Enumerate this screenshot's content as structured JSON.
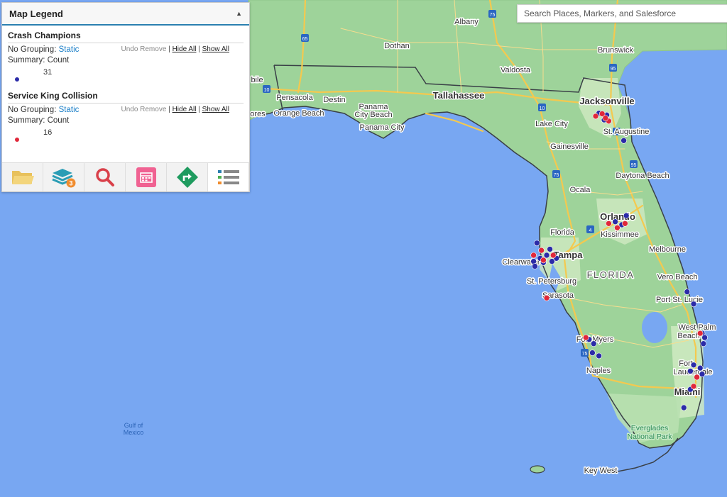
{
  "legend": {
    "title": "Map Legend",
    "collapse_icon": "▲",
    "layers": [
      {
        "name": "Crash Champions",
        "grouping_label": "No Grouping:",
        "grouping_value": "Static",
        "summary_label": "Summary:",
        "summary_value": "Count",
        "undo_remove": "Undo Remove",
        "hide_all": "Hide All",
        "show_all": "Show All",
        "separator": "|",
        "count": "31",
        "color": "#2b2ba8"
      },
      {
        "name": "Service King Collision",
        "grouping_label": "No Grouping:",
        "grouping_value": "Static",
        "summary_label": "Summary:",
        "summary_value": "Count",
        "undo_remove": "Undo Remove",
        "hide_all": "Hide All",
        "show_all": "Show All",
        "separator": "|",
        "count": "16",
        "color": "#e0283a"
      }
    ]
  },
  "toolbar": {
    "buttons": [
      {
        "icon": "folder-icon",
        "color": "#e8c15c"
      },
      {
        "icon": "layers-icon",
        "color": "#2a9db5",
        "badge": "3",
        "badge_color": "#f08c2e"
      },
      {
        "icon": "search-icon",
        "color": "#d9404a"
      },
      {
        "icon": "calendar-icon",
        "color": "#f06292"
      },
      {
        "icon": "directions-icon",
        "color": "#1f9b5f"
      },
      {
        "icon": "legend-list-icon",
        "color": "#888888",
        "active": true
      }
    ]
  },
  "search": {
    "placeholder": "Search Places, Markers, and Salesforce"
  },
  "map": {
    "state_label": "FLORIDA",
    "water_label_line1": "Gulf of",
    "water_label_line2": "Mexico",
    "park_label_line1": "Everglades",
    "park_label_line2": "National Park",
    "cities": {
      "albany": "Albany",
      "dothan": "Dothan",
      "brunswick": "Brunswick",
      "valdosta": "Valdosta",
      "pensacola": "Pensacola",
      "destin": "Destin",
      "orange_beach": "Orange Beach",
      "panama_city_beach_1": "Panama",
      "panama_city_beach_2": "City Beach",
      "panama_city": "Panama City",
      "tallahassee": "Tallahassee",
      "jacksonville": "Jacksonville",
      "lake_city": "Lake City",
      "st_augustine": "St. Augustine",
      "gainesville": "Gainesville",
      "daytona_beach": "Daytona Beach",
      "ocala": "Ocala",
      "orlando": "Orlando",
      "kissimmee": "Kissimmee",
      "melbourne": "Melbourne",
      "florida_city": "Florida",
      "tampa": "Tampa",
      "clearwater": "Clearwater",
      "st_petersburg": "St. Petersburg",
      "sarasota": "Sarasota",
      "vero_beach": "Vero Beach",
      "port_st_lucie": "Port St. Lucie",
      "west_palm_1": "West Palm",
      "west_palm_2": "Beach",
      "fort_myers": "Fort Myers",
      "naples": "Naples",
      "fort_lauderdale_1": "Fort",
      "fort_lauderdale_2": "Lauderdale",
      "miami": "Miami",
      "key_west": "Key West",
      "mobile_partial": "bile",
      "gores_partial": "ores"
    },
    "highway_shields": [
      "65",
      "10",
      "75",
      "95",
      "4",
      "75",
      "95",
      "75",
      "95",
      "10"
    ],
    "colors": {
      "water": "#78a7f2",
      "land": "#9ed39a",
      "land_light": "#cfeac2",
      "road": "#f4c94f",
      "border": "#3a4047"
    }
  },
  "markers": {
    "crash_champions": [
      [
        -81.7,
        30.33
      ],
      [
        -81.58,
        30.3
      ],
      [
        -81.62,
        30.22
      ],
      [
        -81.32,
        29.88
      ],
      [
        -81.28,
        28.65
      ],
      [
        -81.45,
        28.55
      ],
      [
        -81.35,
        28.5
      ],
      [
        -82.65,
        28.2
      ],
      [
        -82.45,
        28.1
      ],
      [
        -82.5,
        28.0
      ],
      [
        -82.6,
        27.95
      ],
      [
        -82.55,
        27.88
      ],
      [
        -82.7,
        27.9
      ],
      [
        -82.68,
        27.82
      ],
      [
        -82.35,
        27.95
      ],
      [
        -82.42,
        27.9
      ],
      [
        -80.35,
        27.4
      ],
      [
        -80.25,
        27.2
      ],
      [
        -80.12,
        26.72
      ],
      [
        -80.08,
        26.65
      ],
      [
        -80.1,
        26.55
      ],
      [
        -81.85,
        26.62
      ],
      [
        -81.78,
        26.55
      ],
      [
        -81.8,
        26.4
      ],
      [
        -81.7,
        26.35
      ],
      [
        -80.25,
        26.2
      ],
      [
        -80.15,
        26.15
      ],
      [
        -80.12,
        26.05
      ],
      [
        -80.3,
        26.1
      ],
      [
        -80.3,
        25.8
      ],
      [
        -80.4,
        25.5
      ]
    ],
    "service_king": [
      [
        -81.75,
        30.28
      ],
      [
        -81.65,
        30.32
      ],
      [
        -81.55,
        30.2
      ],
      [
        -81.6,
        30.25
      ],
      [
        -81.55,
        28.52
      ],
      [
        -81.3,
        28.52
      ],
      [
        -81.42,
        28.45
      ],
      [
        -82.58,
        28.08
      ],
      [
        -82.4,
        28.0
      ],
      [
        -82.7,
        28.0
      ],
      [
        -82.55,
        27.92
      ],
      [
        -82.5,
        27.3
      ],
      [
        -80.15,
        26.72
      ],
      [
        -81.9,
        26.65
      ],
      [
        -80.2,
        26.0
      ],
      [
        -80.25,
        25.85
      ]
    ]
  }
}
